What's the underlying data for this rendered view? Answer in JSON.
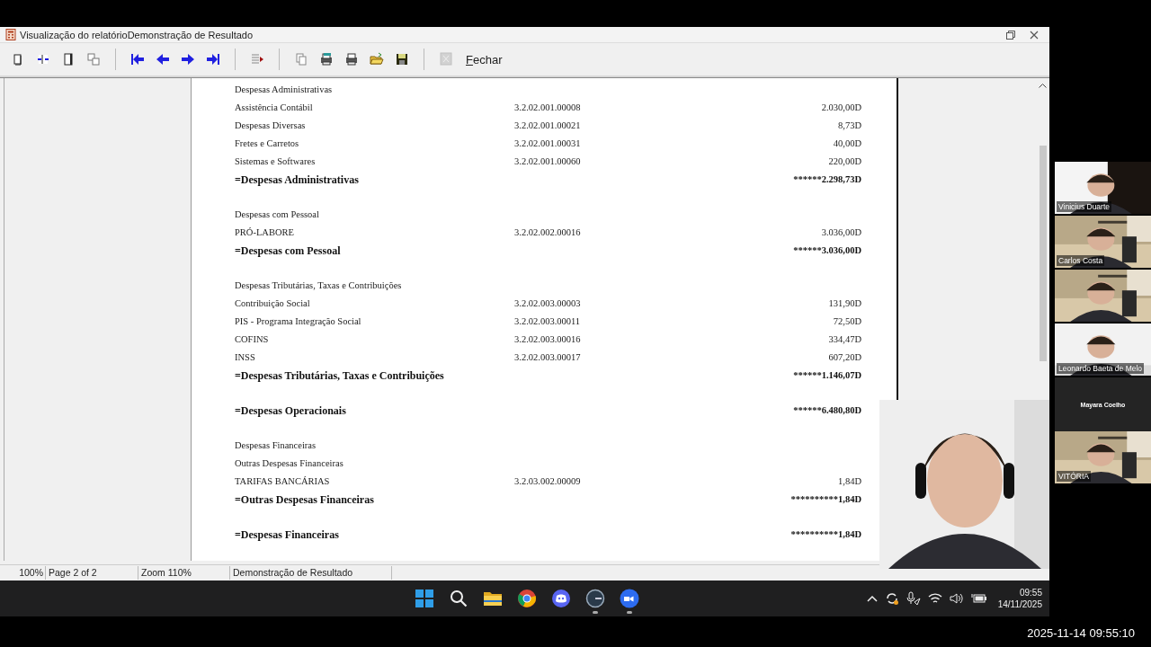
{
  "window": {
    "title": "Visualização do relatórioDemonstração de Resultado",
    "toolbar": {
      "buttons": [
        {
          "kind": "page-single",
          "disabled": false
        },
        {
          "kind": "page-width",
          "disabled": false
        },
        {
          "kind": "page-full",
          "disabled": false
        },
        {
          "kind": "pages-multi",
          "disabled": false
        },
        {
          "kind": "sep"
        },
        {
          "kind": "first",
          "disabled": false
        },
        {
          "kind": "prev",
          "disabled": false
        },
        {
          "kind": "next",
          "disabled": false
        },
        {
          "kind": "last",
          "disabled": false
        },
        {
          "kind": "sep"
        },
        {
          "kind": "goto",
          "disabled": false
        },
        {
          "kind": "sep"
        },
        {
          "kind": "copy",
          "disabled": false
        },
        {
          "kind": "print-setup",
          "disabled": false
        },
        {
          "kind": "print",
          "disabled": false
        },
        {
          "kind": "open",
          "disabled": false
        },
        {
          "kind": "save",
          "disabled": false
        },
        {
          "kind": "sep"
        },
        {
          "kind": "export",
          "disabled": true
        }
      ],
      "close_label": "Fechar"
    },
    "report": {
      "rows": [
        {
          "kind": "header",
          "label": "Despesas Administrativas"
        },
        {
          "kind": "item",
          "label": "Assistência Contábil",
          "code": "3.2.02.001.00008",
          "value": "2.030,00D"
        },
        {
          "kind": "item",
          "label": "Despesas Diversas",
          "code": "3.2.02.001.00021",
          "value": "8,73D"
        },
        {
          "kind": "item",
          "label": "Fretes e Carretos",
          "code": "3.2.02.001.00031",
          "value": "40,00D"
        },
        {
          "kind": "item",
          "label": "Sistemas e Softwares",
          "code": "3.2.02.001.00060",
          "value": "220,00D"
        },
        {
          "kind": "total",
          "label": "=Despesas Administrativas",
          "value": "******2.298,73D"
        },
        {
          "kind": "header",
          "label": "Despesas com Pessoal",
          "gap_before": true
        },
        {
          "kind": "item",
          "label": "PRÓ-LABORE",
          "code": "3.2.02.002.00016",
          "value": "3.036,00D"
        },
        {
          "kind": "total",
          "label": "=Despesas com Pessoal",
          "value": "******3.036,00D"
        },
        {
          "kind": "header",
          "label": "Despesas Tributárias, Taxas e Contribuições",
          "gap_before": true
        },
        {
          "kind": "item",
          "label": "Contribuição Social",
          "code": "3.2.02.003.00003",
          "value": "131,90D"
        },
        {
          "kind": "item",
          "label": "PIS - Programa Integração Social",
          "code": "3.2.02.003.00011",
          "value": "72,50D"
        },
        {
          "kind": "item",
          "label": "COFINS",
          "code": "3.2.02.003.00016",
          "value": "334,47D"
        },
        {
          "kind": "item",
          "label": "INSS",
          "code": "3.2.02.003.00017",
          "value": "607,20D"
        },
        {
          "kind": "total",
          "label": "=Despesas Tributárias, Taxas e Contribuições",
          "value": "******1.146,07D"
        },
        {
          "kind": "total",
          "label": "=Despesas Operacionais",
          "value": "******6.480,80D",
          "gap_before": true
        },
        {
          "kind": "header",
          "label": "Despesas Financeiras",
          "gap_before": true
        },
        {
          "kind": "header",
          "label": "Outras Despesas Financeiras"
        },
        {
          "kind": "item",
          "label": "TARIFAS BANCÁRIAS",
          "code": "3.2.03.002.00009",
          "value": "1,84D"
        },
        {
          "kind": "total",
          "label": "=Outras Despesas Financeiras",
          "value": "**********1,84D"
        },
        {
          "kind": "total",
          "label": "=Despesas Financeiras",
          "value": "**********1,84D",
          "gap_before": true
        }
      ]
    },
    "status_bar": {
      "zoom_percent": "100%",
      "page": "Page 2 of 2",
      "zoom": "Zoom 110%",
      "report_name": "Demonstração de Resultado"
    }
  },
  "taskbar": {
    "apps": [
      {
        "kind": "start",
        "running": false
      },
      {
        "kind": "search",
        "running": false
      },
      {
        "kind": "folder",
        "running": false
      },
      {
        "kind": "browser",
        "running": false
      },
      {
        "kind": "chat",
        "running": false
      },
      {
        "kind": "clock-app",
        "running": true
      },
      {
        "kind": "meeting",
        "running": true
      }
    ],
    "time": "09:55",
    "date": "14/11/2025"
  },
  "video_call": {
    "participants": [
      {
        "kind": "dark_video",
        "name": "Vinicius Duarte"
      },
      {
        "kind": "office_video",
        "name": "Carlos Costa"
      },
      {
        "kind": "office_video"
      },
      {
        "kind": "white_video",
        "name": "Leonardo Baeta de Melo"
      },
      {
        "kind": "name_only",
        "name": "Mayara Coelho"
      },
      {
        "kind": "office_video",
        "name": "VITÓRIA"
      }
    ]
  },
  "recording_timestamp": "2025-11-14 09:55:10"
}
